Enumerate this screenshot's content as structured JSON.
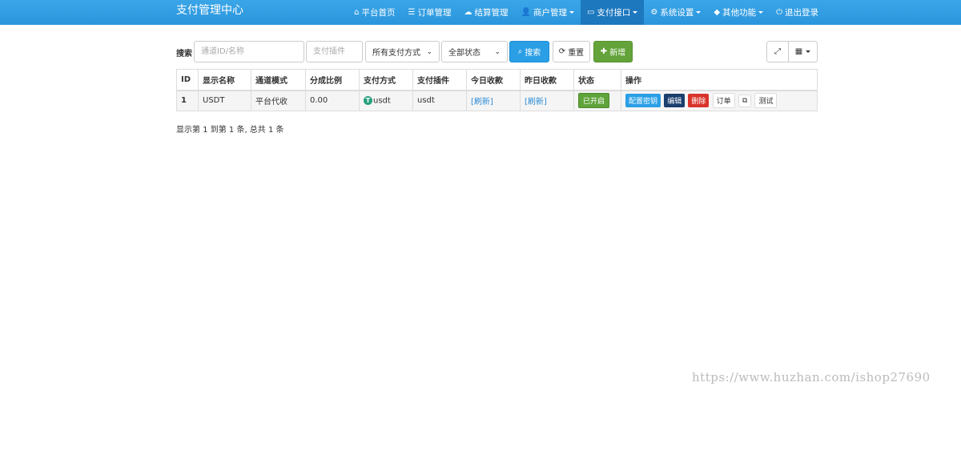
{
  "navbar": {
    "brand": "支付管理中心",
    "items": [
      {
        "icon": "home-icon",
        "glyph": "⌂",
        "label": "平台首页"
      },
      {
        "icon": "list-icon",
        "glyph": "☰",
        "label": "订单管理"
      },
      {
        "icon": "cloud-icon",
        "glyph": "☁",
        "label": "结算管理"
      },
      {
        "icon": "user-icon",
        "glyph": "👤",
        "label": "商户管理"
      },
      {
        "icon": "credit-card-icon",
        "glyph": "▭",
        "label": "支付接口"
      },
      {
        "icon": "gear-icon",
        "glyph": "⚙",
        "label": "系统设置"
      },
      {
        "icon": "cube-icon",
        "glyph": "◆",
        "label": "其他功能"
      },
      {
        "icon": "power-icon",
        "glyph": "⏻",
        "label": "退出登录"
      }
    ]
  },
  "toolbar": {
    "search_label": "搜索",
    "id_placeholder": "通道ID/名称",
    "plugin_placeholder": "支付插件",
    "method_select": "所有支付方式",
    "status_select": "全部状态",
    "search_button": "搜索",
    "reset_button": "重置",
    "add_button": "新增"
  },
  "table": {
    "headers": [
      "ID",
      "显示名称",
      "通道模式",
      "分成比例",
      "支付方式",
      "支付插件",
      "今日收款",
      "昨日收款",
      "状态",
      "操作"
    ],
    "rows": [
      {
        "id": "1",
        "name": "USDT",
        "mode": "平台代收",
        "rate": "0.00",
        "method": "usdt",
        "method_icon": "T",
        "plugin": "usdt",
        "today": "[刷新]",
        "yesterday": "[刷新]",
        "status": "已开启",
        "actions": {
          "config_key": "配置密钥",
          "edit": "编辑",
          "delete": "删除",
          "orders": "订单",
          "copy": "⧉",
          "test": "测试"
        }
      }
    ]
  },
  "pagination_text": "显示第 1 到第 1 条, 总共 1 条",
  "watermark": "https://www.huzhan.com/ishop27690"
}
